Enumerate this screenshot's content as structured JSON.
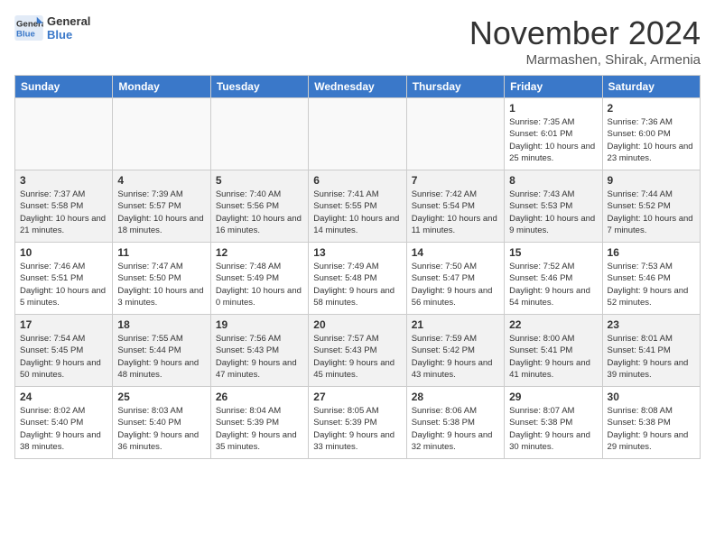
{
  "header": {
    "logo_line1": "General",
    "logo_line2": "Blue",
    "month": "November 2024",
    "location": "Marmashen, Shirak, Armenia"
  },
  "days_of_week": [
    "Sunday",
    "Monday",
    "Tuesday",
    "Wednesday",
    "Thursday",
    "Friday",
    "Saturday"
  ],
  "weeks": [
    [
      {
        "day": "",
        "info": ""
      },
      {
        "day": "",
        "info": ""
      },
      {
        "day": "",
        "info": ""
      },
      {
        "day": "",
        "info": ""
      },
      {
        "day": "",
        "info": ""
      },
      {
        "day": "1",
        "info": "Sunrise: 7:35 AM\nSunset: 6:01 PM\nDaylight: 10 hours and 25 minutes."
      },
      {
        "day": "2",
        "info": "Sunrise: 7:36 AM\nSunset: 6:00 PM\nDaylight: 10 hours and 23 minutes."
      }
    ],
    [
      {
        "day": "3",
        "info": "Sunrise: 7:37 AM\nSunset: 5:58 PM\nDaylight: 10 hours and 21 minutes."
      },
      {
        "day": "4",
        "info": "Sunrise: 7:39 AM\nSunset: 5:57 PM\nDaylight: 10 hours and 18 minutes."
      },
      {
        "day": "5",
        "info": "Sunrise: 7:40 AM\nSunset: 5:56 PM\nDaylight: 10 hours and 16 minutes."
      },
      {
        "day": "6",
        "info": "Sunrise: 7:41 AM\nSunset: 5:55 PM\nDaylight: 10 hours and 14 minutes."
      },
      {
        "day": "7",
        "info": "Sunrise: 7:42 AM\nSunset: 5:54 PM\nDaylight: 10 hours and 11 minutes."
      },
      {
        "day": "8",
        "info": "Sunrise: 7:43 AM\nSunset: 5:53 PM\nDaylight: 10 hours and 9 minutes."
      },
      {
        "day": "9",
        "info": "Sunrise: 7:44 AM\nSunset: 5:52 PM\nDaylight: 10 hours and 7 minutes."
      }
    ],
    [
      {
        "day": "10",
        "info": "Sunrise: 7:46 AM\nSunset: 5:51 PM\nDaylight: 10 hours and 5 minutes."
      },
      {
        "day": "11",
        "info": "Sunrise: 7:47 AM\nSunset: 5:50 PM\nDaylight: 10 hours and 3 minutes."
      },
      {
        "day": "12",
        "info": "Sunrise: 7:48 AM\nSunset: 5:49 PM\nDaylight: 10 hours and 0 minutes."
      },
      {
        "day": "13",
        "info": "Sunrise: 7:49 AM\nSunset: 5:48 PM\nDaylight: 9 hours and 58 minutes."
      },
      {
        "day": "14",
        "info": "Sunrise: 7:50 AM\nSunset: 5:47 PM\nDaylight: 9 hours and 56 minutes."
      },
      {
        "day": "15",
        "info": "Sunrise: 7:52 AM\nSunset: 5:46 PM\nDaylight: 9 hours and 54 minutes."
      },
      {
        "day": "16",
        "info": "Sunrise: 7:53 AM\nSunset: 5:46 PM\nDaylight: 9 hours and 52 minutes."
      }
    ],
    [
      {
        "day": "17",
        "info": "Sunrise: 7:54 AM\nSunset: 5:45 PM\nDaylight: 9 hours and 50 minutes."
      },
      {
        "day": "18",
        "info": "Sunrise: 7:55 AM\nSunset: 5:44 PM\nDaylight: 9 hours and 48 minutes."
      },
      {
        "day": "19",
        "info": "Sunrise: 7:56 AM\nSunset: 5:43 PM\nDaylight: 9 hours and 47 minutes."
      },
      {
        "day": "20",
        "info": "Sunrise: 7:57 AM\nSunset: 5:43 PM\nDaylight: 9 hours and 45 minutes."
      },
      {
        "day": "21",
        "info": "Sunrise: 7:59 AM\nSunset: 5:42 PM\nDaylight: 9 hours and 43 minutes."
      },
      {
        "day": "22",
        "info": "Sunrise: 8:00 AM\nSunset: 5:41 PM\nDaylight: 9 hours and 41 minutes."
      },
      {
        "day": "23",
        "info": "Sunrise: 8:01 AM\nSunset: 5:41 PM\nDaylight: 9 hours and 39 minutes."
      }
    ],
    [
      {
        "day": "24",
        "info": "Sunrise: 8:02 AM\nSunset: 5:40 PM\nDaylight: 9 hours and 38 minutes."
      },
      {
        "day": "25",
        "info": "Sunrise: 8:03 AM\nSunset: 5:40 PM\nDaylight: 9 hours and 36 minutes."
      },
      {
        "day": "26",
        "info": "Sunrise: 8:04 AM\nSunset: 5:39 PM\nDaylight: 9 hours and 35 minutes."
      },
      {
        "day": "27",
        "info": "Sunrise: 8:05 AM\nSunset: 5:39 PM\nDaylight: 9 hours and 33 minutes."
      },
      {
        "day": "28",
        "info": "Sunrise: 8:06 AM\nSunset: 5:38 PM\nDaylight: 9 hours and 32 minutes."
      },
      {
        "day": "29",
        "info": "Sunrise: 8:07 AM\nSunset: 5:38 PM\nDaylight: 9 hours and 30 minutes."
      },
      {
        "day": "30",
        "info": "Sunrise: 8:08 AM\nSunset: 5:38 PM\nDaylight: 9 hours and 29 minutes."
      }
    ]
  ]
}
